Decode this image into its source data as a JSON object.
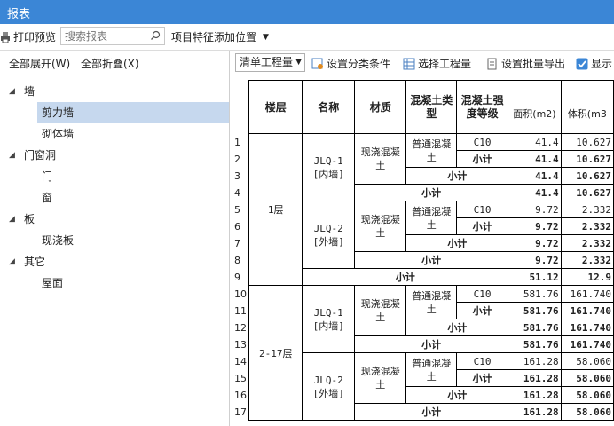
{
  "window": {
    "title": "报表"
  },
  "toolbar": {
    "print_preview": "打印预览",
    "search_placeholder": "搜索报表",
    "add_position": "项目特征添加位置"
  },
  "left": {
    "expand_all": "全部展开(W)",
    "collapse_all": "全部折叠(X)",
    "tree": [
      {
        "label": "墙",
        "level": 0
      },
      {
        "label": "剪力墙",
        "level": 1,
        "selected": true
      },
      {
        "label": "砌体墙",
        "level": 1
      },
      {
        "label": "门窗洞",
        "level": 0
      },
      {
        "label": "门",
        "level": 1
      },
      {
        "label": "窗",
        "level": 1
      },
      {
        "label": "板",
        "level": 0
      },
      {
        "label": "现浇板",
        "level": 1
      },
      {
        "label": "其它",
        "level": 0
      },
      {
        "label": "屋面",
        "level": 1
      }
    ]
  },
  "right_toolbar": {
    "dropdown": "清单工程量",
    "set_category": "设置分类条件",
    "select_qty": "选择工程量",
    "batch_export": "设置批量导出",
    "show": "显示"
  },
  "table": {
    "headers": {
      "floor": "楼层",
      "name": "名称",
      "material": "材质",
      "concrete_type": "混凝土类型",
      "concrete_grade": "混凝土强度等级",
      "area": "面积(m2)",
      "volume": "体积(m3"
    },
    "row_numbers": [
      "1",
      "2",
      "3",
      "4",
      "5",
      "6",
      "7",
      "8",
      "9",
      "10",
      "11",
      "12",
      "13",
      "14",
      "15",
      "16",
      "17"
    ],
    "floors": [
      "1层",
      "2-17层"
    ],
    "names": [
      "JLQ-1 [内墙]",
      "JLQ-2 [外墙]",
      "JLQ-1 [内墙]",
      "JLQ-2 [外墙]"
    ],
    "material": "现浇混凝土",
    "ctype": "普通混凝土",
    "grade": "C10",
    "subtotal": "小计",
    "areas": [
      "41.4",
      "41.4",
      "41.4",
      "41.4",
      "9.72",
      "9.72",
      "9.72",
      "9.72",
      "51.12",
      "581.76",
      "581.76",
      "581.76",
      "581.76",
      "161.28",
      "161.28",
      "161.28",
      "161.28"
    ],
    "volumes": [
      "10.627",
      "10.627",
      "10.627",
      "10.627",
      "2.332",
      "2.332",
      "2.332",
      "2.332",
      "12.9",
      "161.740",
      "161.740",
      "161.740",
      "161.740",
      "58.060",
      "58.060",
      "58.060",
      "58.060"
    ]
  }
}
